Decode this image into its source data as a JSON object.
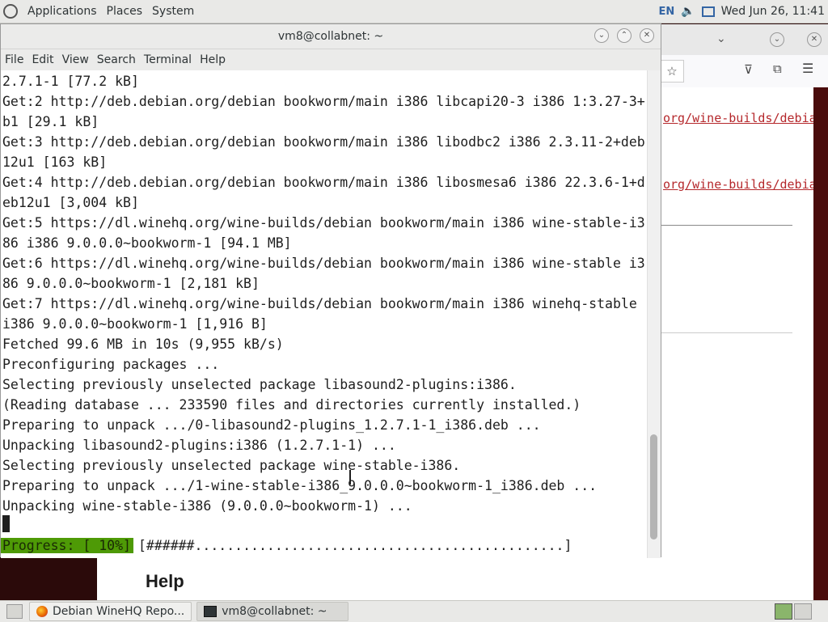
{
  "top_panel": {
    "menus": [
      "Applications",
      "Places",
      "System"
    ],
    "lang": "EN",
    "clock": "Wed Jun 26, 11:41"
  },
  "browser": {
    "link_fragment": "org/wine-builds/debia",
    "help_heading": "Help"
  },
  "terminal": {
    "title": "vm8@collabnet: ~",
    "menu": [
      "File",
      "Edit",
      "View",
      "Search",
      "Terminal",
      "Help"
    ],
    "lines": [
      "2.7.1-1 [77.2 kB]",
      "Get:2 http://deb.debian.org/debian bookworm/main i386 libcapi20-3 i386 1:3.27-3+",
      "b1 [29.1 kB]",
      "Get:3 http://deb.debian.org/debian bookworm/main i386 libodbc2 i386 2.3.11-2+deb",
      "12u1 [163 kB]",
      "Get:4 http://deb.debian.org/debian bookworm/main i386 libosmesa6 i386 22.3.6-1+d",
      "eb12u1 [3,004 kB]",
      "Get:5 https://dl.winehq.org/wine-builds/debian bookworm/main i386 wine-stable-i3",
      "86 i386 9.0.0.0~bookworm-1 [94.1 MB]",
      "Get:6 https://dl.winehq.org/wine-builds/debian bookworm/main i386 wine-stable i3",
      "86 9.0.0.0~bookworm-1 [2,181 kB]",
      "Get:7 https://dl.winehq.org/wine-builds/debian bookworm/main i386 winehq-stable",
      "i386 9.0.0.0~bookworm-1 [1,916 B]",
      "Fetched 99.6 MB in 10s (9,955 kB/s)",
      "Preconfiguring packages ...",
      "Selecting previously unselected package libasound2-plugins:i386.",
      "(Reading database ... 233590 files and directories currently installed.)",
      "Preparing to unpack .../0-libasound2-plugins_1.2.7.1-1_i386.deb ...",
      "Unpacking libasound2-plugins:i386 (1.2.7.1-1) ...",
      "Selecting previously unselected package wine-stable-i386.",
      "Preparing to unpack .../1-wine-stable-i386_9.0.0.0~bookworm-1_i386.deb ...",
      "Unpacking wine-stable-i386 (9.0.0.0~bookworm-1) ..."
    ],
    "progress_label": "Progress: [ 10%]",
    "progress_bar": "[######..............................................]",
    "progress_fraction": 0.1
  },
  "taskbar": {
    "items": [
      "Debian WineHQ Repo...",
      "vm8@collabnet: ~"
    ]
  }
}
